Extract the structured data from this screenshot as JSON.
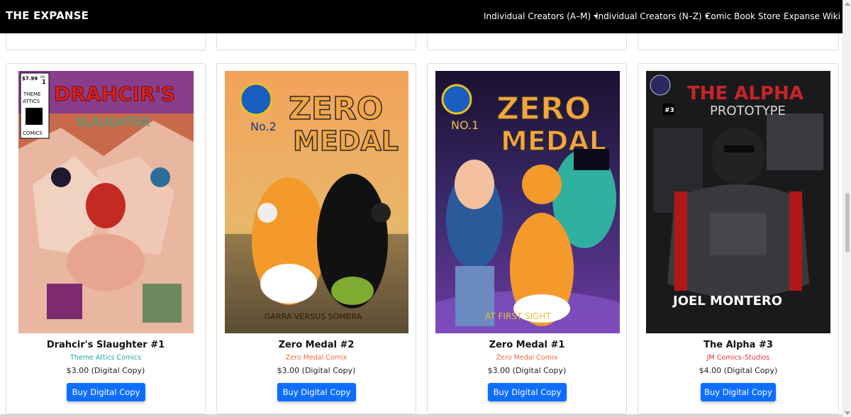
{
  "navbar": {
    "brand": "THE EXPANSE",
    "items": [
      {
        "label": "Individual Creators (A–M)",
        "dropdown": true
      },
      {
        "label": "Individual Creators (N–Z)",
        "dropdown": true
      },
      {
        "label": "Comic Book Store",
        "dropdown": false
      },
      {
        "label": "Expanse Wiki",
        "dropdown": false
      }
    ]
  },
  "products": [
    {
      "title": "Drahcir's Slaughter #1",
      "publisher": "Theme Attics Comics",
      "publisher_color": "#20a6a6",
      "price": "$3.00 (Digital Copy)",
      "button": "Buy Digital Copy",
      "cover": {
        "title_text": "DRAHCIR'S",
        "subtitle_text": "SLAUGHTER",
        "price_tag": "$7.99",
        "badge_lines": [
          "THEME",
          "ATTICS",
          "COMICS"
        ],
        "issue": "1",
        "issue_label": "ISS"
      }
    },
    {
      "title": "Zero Medal #2",
      "publisher": "Zero Medal Comix",
      "publisher_color": "#f06a3c",
      "price": "$3.00 (Digital Copy)",
      "button": "Buy Digital Copy",
      "cover": {
        "title_line1": "ZERO",
        "title_line2": "MEDAL",
        "issue": "No.2",
        "caption": "GARRA VERSUS SOMBRA"
      }
    },
    {
      "title": "Zero Medal #1",
      "publisher": "Zero Medal Comix",
      "publisher_color": "#f06a3c",
      "price": "$3.00 (Digital Copy)",
      "button": "Buy Digital Copy",
      "cover": {
        "title_line1": "ZERO",
        "title_line2": "MEDAL",
        "issue": "NO.1",
        "caption": "AT FIRST SIGHT"
      }
    },
    {
      "title": "The Alpha #3",
      "publisher": "JM Comics–Studios",
      "publisher_color": "#e8303a",
      "price": "$4.00 (Digital Copy)",
      "button": "Buy Digital Copy",
      "cover": {
        "title_text": "THE ALPHA",
        "subtitle_text": "PROTOTYPE",
        "issue": "#3",
        "author": "JOEL MONTERO"
      }
    }
  ]
}
